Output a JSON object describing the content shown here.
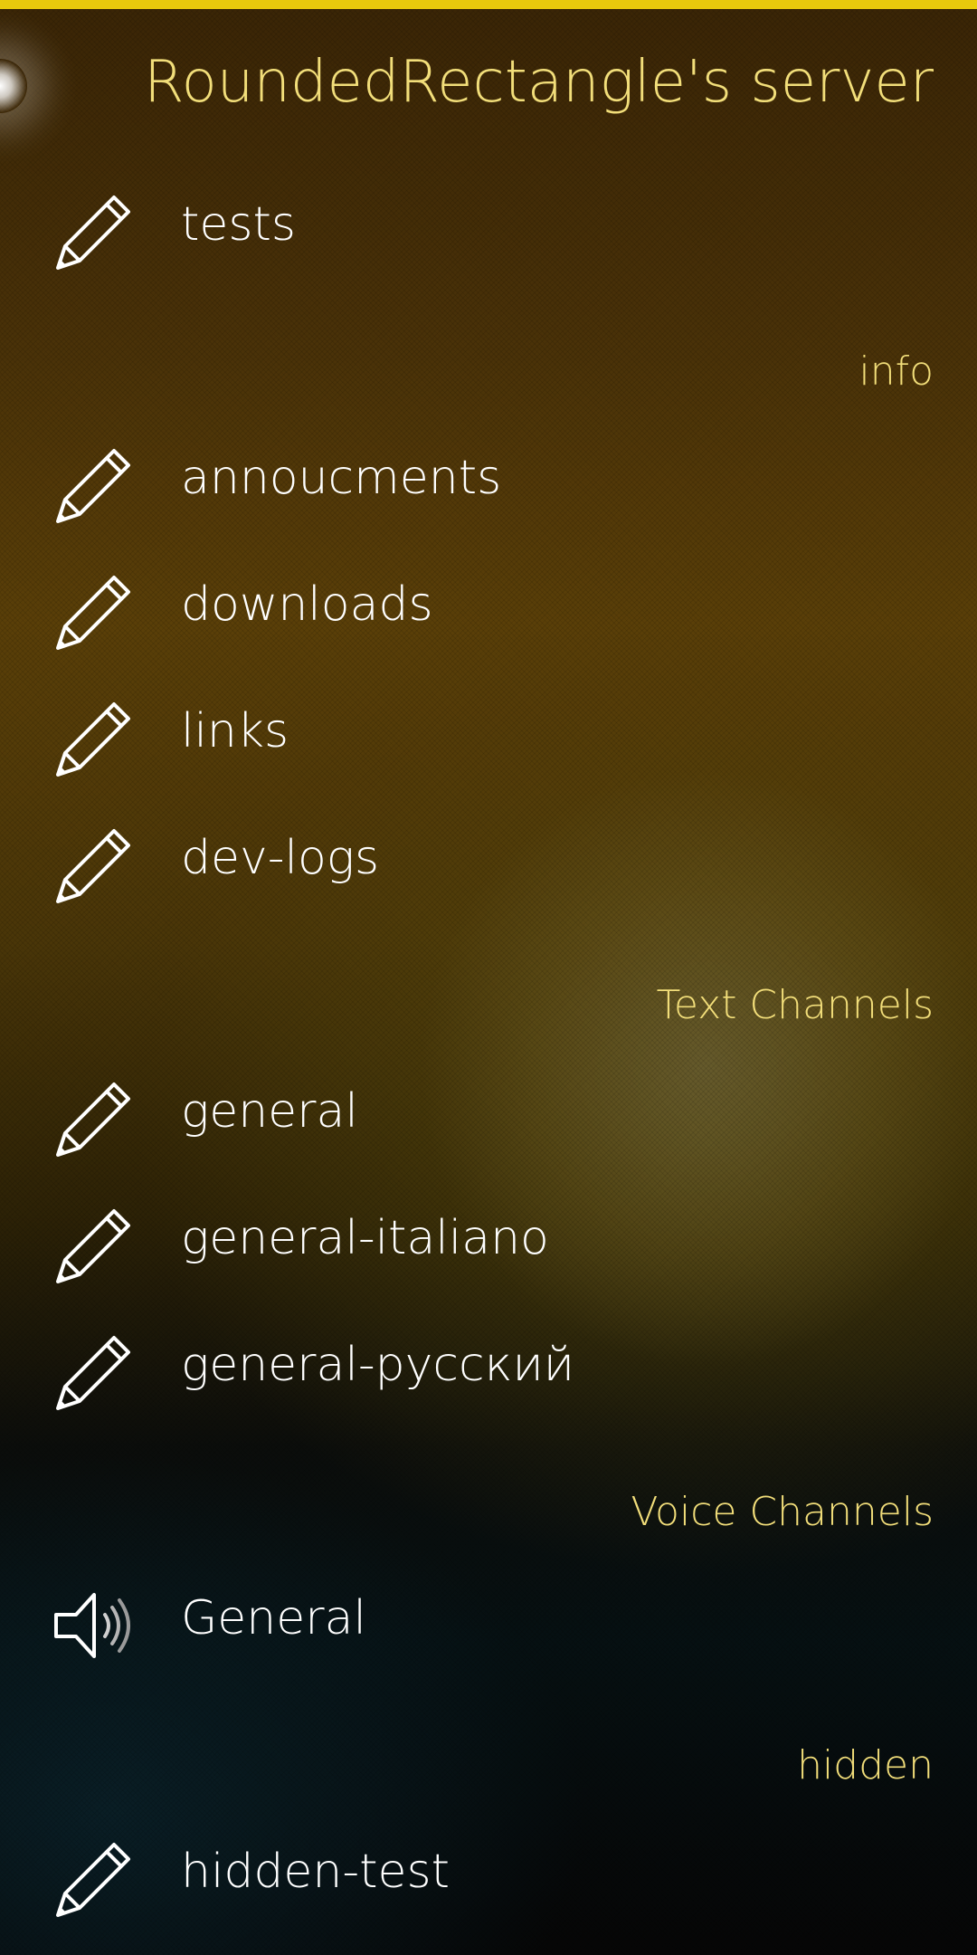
{
  "server": {
    "name": "RoundedRectangle's server"
  },
  "channels": {
    "top": [
      {
        "name": "tests",
        "icon": "pencil-icon"
      }
    ],
    "sections": [
      {
        "title": "info",
        "items": [
          {
            "name": "annoucments",
            "icon": "pencil-icon"
          },
          {
            "name": "downloads",
            "icon": "pencil-icon"
          },
          {
            "name": "links",
            "icon": "pencil-icon"
          },
          {
            "name": "dev-logs",
            "icon": "pencil-icon"
          }
        ]
      },
      {
        "title": "Text Channels",
        "items": [
          {
            "name": "general",
            "icon": "pencil-icon"
          },
          {
            "name": "general-italiano",
            "icon": "pencil-icon"
          },
          {
            "name": "general-русский",
            "icon": "pencil-icon"
          }
        ]
      },
      {
        "title": "Voice Channels",
        "items": [
          {
            "name": "General",
            "icon": "speaker-icon"
          }
        ]
      },
      {
        "title": "hidden",
        "items": [
          {
            "name": "hidden-test",
            "icon": "pencil-icon"
          }
        ]
      }
    ]
  },
  "colors": {
    "accent": "#e8c90c",
    "header_text": "#f2de7a",
    "item_text": "#ffffff"
  }
}
